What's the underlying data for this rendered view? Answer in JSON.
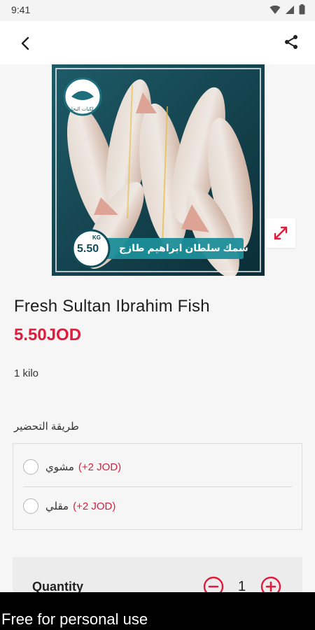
{
  "status_bar": {
    "time": "9:41",
    "icons": [
      "wifi-icon",
      "signal-icon",
      "battery-icon"
    ]
  },
  "app_bar": {
    "back_icon": "chevron-left-icon",
    "share_icon": "share-icon"
  },
  "product": {
    "image_badge_value": "5.50",
    "image_badge_unit": "KG",
    "image_banner_text": "سمك سلطان ابراهيم طازج",
    "image_logo_text": "ملكيات البحار",
    "title": "Fresh Sultan Ibrahim Fish",
    "price": "5.50JOD",
    "unit": "1 kilo"
  },
  "preparation": {
    "label": "طريقة التحضير",
    "options": [
      {
        "name": "مشوي",
        "extra": "(+2 JOD)"
      },
      {
        "name": "مقلي",
        "extra": "(+2 JOD)"
      }
    ]
  },
  "quantity": {
    "label": "Quantity",
    "value": "1"
  },
  "watermark": {
    "text": "Free for personal use"
  },
  "colors": {
    "accent": "#e01b3c",
    "background": "#f6f6f6",
    "card": "#ececec"
  }
}
